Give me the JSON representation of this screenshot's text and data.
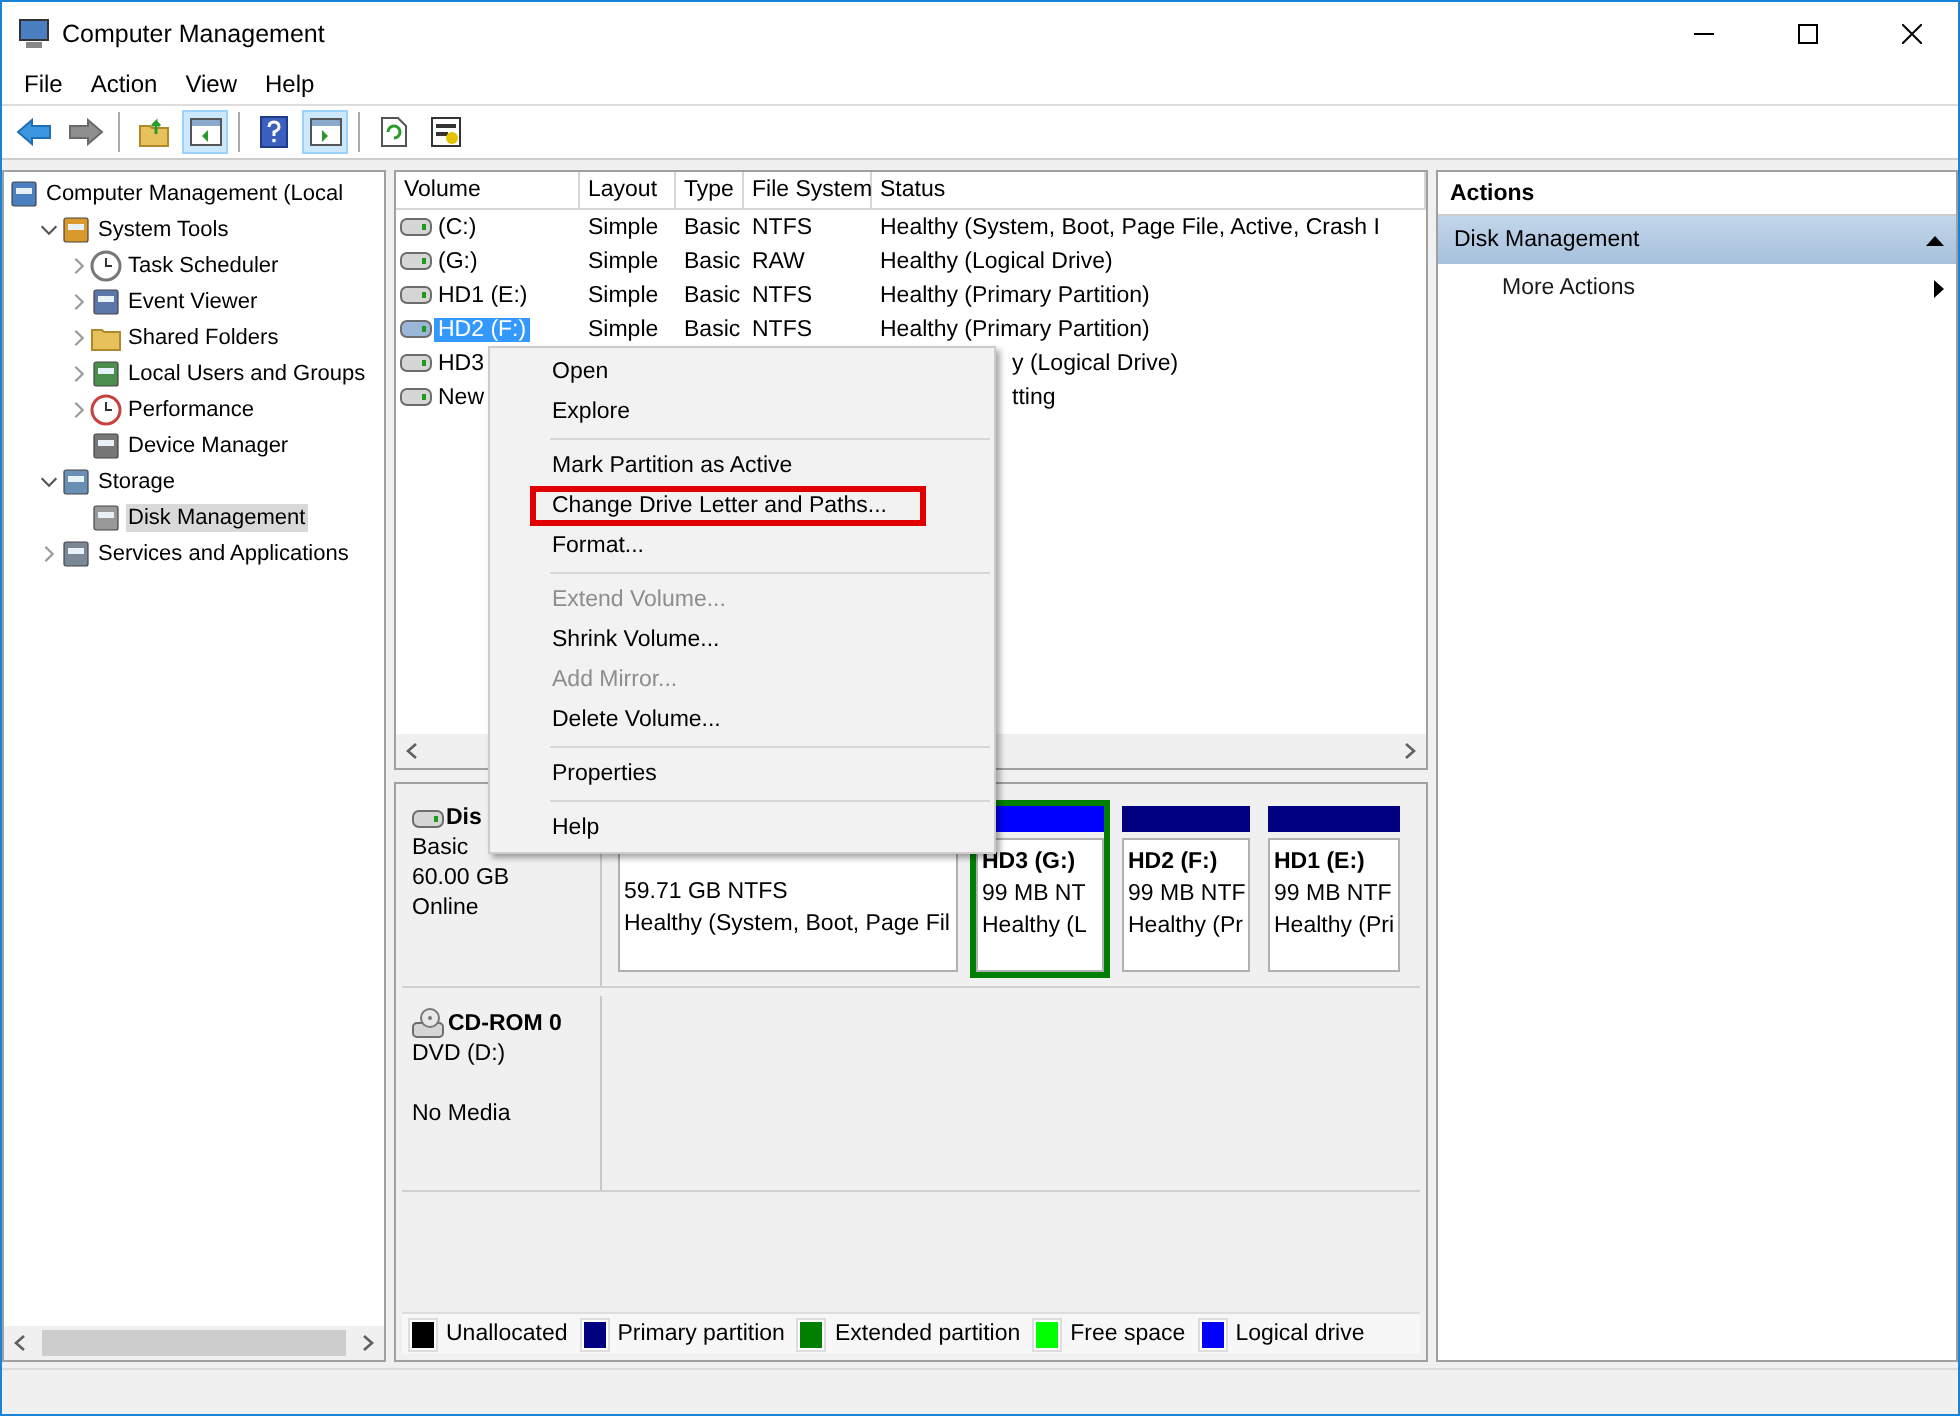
{
  "window": {
    "title": "Computer Management"
  },
  "menu": [
    "File",
    "Action",
    "View",
    "Help"
  ],
  "toolbar": [
    {
      "kind": "back",
      "pressed": false
    },
    {
      "kind": "forward",
      "pressed": false
    },
    {
      "kind": "separator"
    },
    {
      "kind": "up",
      "pressed": false
    },
    {
      "kind": "tree",
      "pressed": true
    },
    {
      "kind": "separator"
    },
    {
      "kind": "help",
      "pressed": false
    },
    {
      "kind": "pane",
      "pressed": true
    },
    {
      "kind": "separator"
    },
    {
      "kind": "refresh",
      "pressed": false
    },
    {
      "kind": "properties",
      "pressed": false
    }
  ],
  "tree": [
    {
      "label": "Computer Management (Local",
      "selected": false,
      "children": [
        {
          "label": "System Tools",
          "expanded": true,
          "selected": false,
          "children": [
            {
              "label": "Task Scheduler",
              "expanded": false,
              "selected": false
            },
            {
              "label": "Event Viewer",
              "expanded": false,
              "selected": false
            },
            {
              "label": "Shared Folders",
              "expanded": false,
              "selected": false
            },
            {
              "label": "Local Users and Groups",
              "expanded": false,
              "selected": false
            },
            {
              "label": "Performance",
              "expanded": false,
              "selected": false
            },
            {
              "label": "Device Manager",
              "selected": false
            }
          ]
        },
        {
          "label": "Storage",
          "expanded": true,
          "selected": false,
          "children": [
            {
              "label": "Disk Management",
              "selected": true
            }
          ]
        },
        {
          "label": "Services and Applications",
          "expanded": false,
          "selected": false
        }
      ]
    }
  ],
  "volume_table": {
    "columns": [
      "Volume",
      "Layout",
      "Type",
      "File System",
      "Status"
    ],
    "rows": [
      {
        "kind": "full",
        "volume": "(C:)",
        "layout": "Simple",
        "type": "Basic",
        "file_system": "NTFS",
        "status": "Healthy (System, Boot, Page File, Active, Crash I",
        "selected": false
      },
      {
        "kind": "full",
        "volume": "(G:)",
        "layout": "Simple",
        "type": "Basic",
        "file_system": "RAW",
        "status": "Healthy (Logical Drive)",
        "selected": false
      },
      {
        "kind": "full",
        "volume": "HD1 (E:)",
        "layout": "Simple",
        "type": "Basic",
        "file_system": "NTFS",
        "status": "Healthy (Primary Partition)",
        "selected": false
      },
      {
        "kind": "full",
        "volume": "HD2 (F:)",
        "layout": "Simple",
        "type": "Basic",
        "file_system": "NTFS",
        "status": "Healthy (Primary Partition)",
        "selected": true
      },
      {
        "kind": "partial",
        "volume": "HD3",
        "status": "y (Logical Drive)",
        "selected": false
      },
      {
        "kind": "partial",
        "volume": "New",
        "status": "tting",
        "selected": false
      }
    ]
  },
  "disks": [
    {
      "kind": "disk",
      "name": "Dis",
      "type": "Basic",
      "size": "60.00 GB",
      "state": "Online",
      "partitions": [
        {
          "kind": "primary",
          "size": "59.71 GB NTFS",
          "status": "Healthy (System, Boot, Page Fil"
        },
        {
          "kind": "logical",
          "name": "HD3  (G:)",
          "size": "99 MB NT",
          "status": "Healthy (L"
        },
        {
          "kind": "primary",
          "name": "HD2  (F:)",
          "size": "99 MB NTF",
          "status": "Healthy (Pr"
        },
        {
          "kind": "primary",
          "name": "HD1  (E:)",
          "size": "99 MB NTF",
          "status": "Healthy (Pri"
        }
      ]
    },
    {
      "kind": "cdrom",
      "name": "CD-ROM 0",
      "type": "DVD (D:)",
      "state": "No Media"
    }
  ],
  "legend": [
    {
      "label": "Unallocated",
      "color": "#000000"
    },
    {
      "label": "Primary partition",
      "color": "#000080"
    },
    {
      "label": "Extended partition",
      "color": "#008000"
    },
    {
      "label": "Free space",
      "color": "#00ff00"
    },
    {
      "label": "Logical drive",
      "color": "#0000ff"
    }
  ],
  "actions": {
    "title": "Actions",
    "section": "Disk Management",
    "items": [
      "More Actions"
    ]
  },
  "context_menu": [
    {
      "kind": "item",
      "label": "Open",
      "disabled": false,
      "highlighted": false
    },
    {
      "kind": "item",
      "label": "Explore",
      "disabled": false,
      "highlighted": false
    },
    {
      "kind": "separator"
    },
    {
      "kind": "item",
      "label": "Mark Partition as Active",
      "disabled": false,
      "highlighted": false
    },
    {
      "kind": "item",
      "label": "Change Drive Letter and Paths...",
      "disabled": false,
      "highlighted": true
    },
    {
      "kind": "item",
      "label": "Format...",
      "disabled": false,
      "highlighted": false
    },
    {
      "kind": "separator"
    },
    {
      "kind": "item",
      "label": "Extend Volume...",
      "disabled": true,
      "highlighted": false
    },
    {
      "kind": "item",
      "label": "Shrink Volume...",
      "disabled": false,
      "highlighted": false
    },
    {
      "kind": "item",
      "label": "Add Mirror...",
      "disabled": true,
      "highlighted": false
    },
    {
      "kind": "item",
      "label": "Delete Volume...",
      "disabled": false,
      "highlighted": false
    },
    {
      "kind": "separator"
    },
    {
      "kind": "item",
      "label": "Properties",
      "disabled": false,
      "highlighted": false
    },
    {
      "kind": "separator"
    },
    {
      "kind": "item",
      "label": "Help",
      "disabled": false,
      "highlighted": false
    }
  ]
}
